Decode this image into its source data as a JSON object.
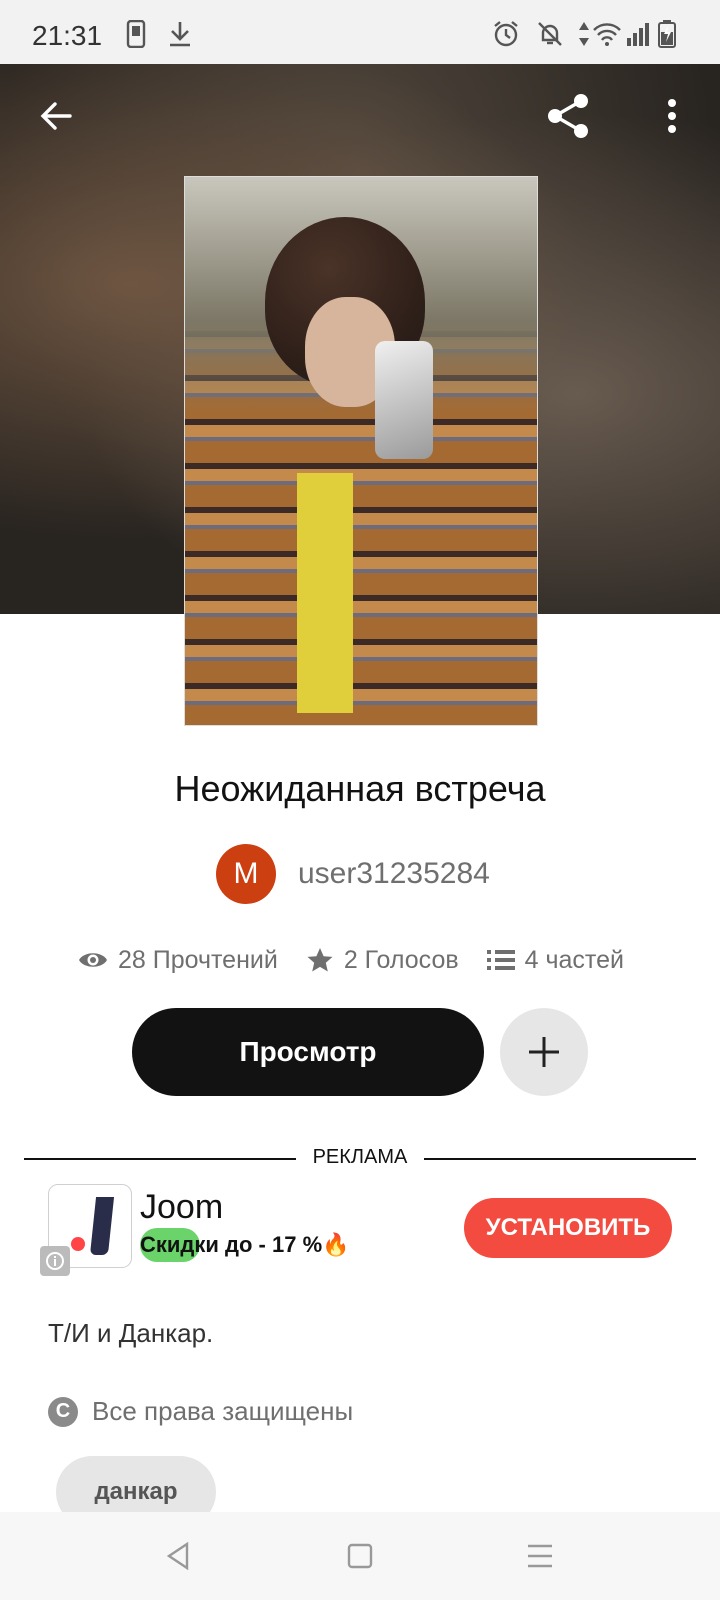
{
  "status_bar": {
    "time": "21:31",
    "icons": [
      "phone-icon",
      "download-icon",
      "alarm-icon",
      "mute-icon",
      "data-arrows-icon",
      "wifi-icon",
      "signal-icon",
      "battery-icon"
    ]
  },
  "header": {
    "back_icon": "arrow-left-icon",
    "share_icon": "share-icon",
    "menu_icon": "more-vert-icon"
  },
  "story": {
    "title": "Неожиданная встреча",
    "author_initial": "M",
    "author_name": "user31235284",
    "reads": "28 Прочтений",
    "votes": "2 Голосов",
    "parts": "4 частей",
    "read_button": "Просмотр",
    "description": "Т/И и Данкар.",
    "rights": "Все права защищены",
    "tags": [
      "данкар"
    ]
  },
  "ad": {
    "label": "РЕКЛАМА",
    "app_name": "Joom",
    "promo": "Скидки до - 17 %🔥",
    "install_button": "УСТАНОВИТЬ"
  },
  "colors": {
    "accent_orange": "#cc3f10",
    "install_red": "#f34b3f",
    "dark_button": "#121212"
  }
}
